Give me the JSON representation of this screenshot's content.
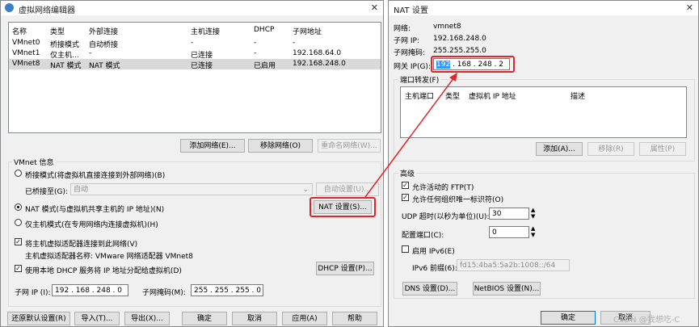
{
  "left": {
    "title": "虚拟网络编辑器",
    "table": {
      "headers": [
        "名称",
        "类型",
        "外部连接",
        "主机连接",
        "DHCP",
        "子网地址"
      ],
      "rows": [
        [
          "VMnet0",
          "桥接模式",
          "自动桥接",
          "-",
          "-",
          "-"
        ],
        [
          "VMnet1",
          "仅主机...",
          "-",
          "已连接",
          "-",
          "192.168.64.0"
        ],
        [
          "VMnet8",
          "NAT 模式",
          "NAT 模式",
          "已连接",
          "已启用",
          "192.168.248.0"
        ]
      ]
    },
    "buttons": {
      "add": "添加网络(E)...",
      "remove": "移除网络(O)",
      "rename": "重命名网络(W)..."
    },
    "info_title": "VMnet 信息",
    "bridge_mode": "桥接模式(将虚拟机直接连接到外部网络)(B)",
    "bridged_to_label": "已桥接至(G):",
    "bridged_to_value": "自动",
    "auto_settings": "自动设置(U)...",
    "nat_mode": "NAT 模式(与虚拟机共享主机的 IP 地址)(N)",
    "nat_settings": "NAT 设置(S)...",
    "host_only": "仅主机模式(在专用网络内连接虚拟机)(H)",
    "connect_adapter": "将主机虚拟适配器连接到此网络(V)",
    "adapter_name": "主机虚拟适配器名称: VMware 网络适配器 VMnet8",
    "use_dhcp": "使用本地 DHCP 服务将 IP 地址分配给虚拟机(D)",
    "dhcp_settings": "DHCP 设置(P)...",
    "subnet_ip_label": "子网 IP (I):",
    "subnet_ip_value": "192 . 168 . 248 .  0",
    "subnet_mask_label": "子网掩码(M):",
    "subnet_mask_value": "255 . 255 . 255 .  0",
    "bottom": {
      "restore": "还原默认设置(R)",
      "import": "导入(T)...",
      "export": "导出(X)...",
      "ok": "确定",
      "cancel": "取消",
      "apply": "应用(A)",
      "help": "帮助"
    }
  },
  "right": {
    "title": "NAT 设置",
    "network_label": "网络:",
    "network_value": "vmnet8",
    "subnet_ip_label": "子网 IP:",
    "subnet_ip_value": "192.168.248.0",
    "subnet_mask_label": "子网掩码:",
    "subnet_mask_value": "255.255.255.0",
    "gateway_label": "网关 IP(G):",
    "gateway_sel": "192",
    "gateway_rest": " . 168 . 248 .  2",
    "port_forward_title": "端口转发(F)",
    "port_headers": [
      "主机端口",
      "类型",
      "虚拟机 IP 地址",
      "描述"
    ],
    "port_buttons": {
      "add": "添加(A)...",
      "remove": "移除(R)",
      "props": "属性(P)"
    },
    "advanced_title": "高级",
    "allow_ftp": "允许活动的 FTP(T)",
    "allow_oui": "允许任何组织唯一标识符(O)",
    "udp_label": "UDP 超时(以秒为单位)(U):",
    "udp_value": "30",
    "config_port_label": "配置端口(C):",
    "config_port_value": "0",
    "ipv6_enable": "启用 IPv6(E)",
    "ipv6_prefix_label": "IPv6 前缀(6):",
    "ipv6_prefix_value": "fd15:4ba5:5a2b:1008::/64",
    "dns_btn": "DNS 设置(D)...",
    "netbios_btn": "NetBIOS 设置(N)...",
    "ok": "确定",
    "cancel": "取消",
    "watermark": "CSDN @我想吃-C"
  },
  "colors": {
    "highlight": "#e0262a",
    "selection": "#3399ff",
    "accent": "#0078d7"
  }
}
